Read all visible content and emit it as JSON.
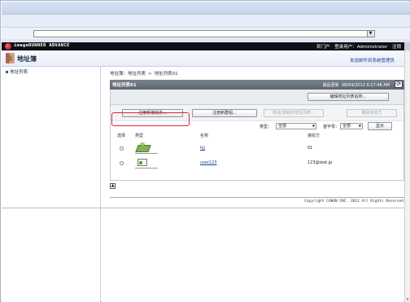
{
  "browser": {
    "address_value": ""
  },
  "app": {
    "product_name": "imageRUNNER ADVANCE",
    "top_links": [
      "到门户",
      "登录用户：Administrator",
      "注销"
    ]
  },
  "header": {
    "title": "地址簿",
    "manage_link": "发送邮件到系统管理员"
  },
  "sidebar": {
    "items": [
      {
        "label": "地址列表"
      }
    ]
  },
  "breadcrumb": {
    "items": [
      "地址簿：地址列表",
      "地址列表01"
    ]
  },
  "panel": {
    "title": "地址列表01",
    "last_updated_label": "最后更新",
    "last_updated_value": "08/04/2012 9:17:48 AM",
    "refresh_icon": "refresh-icon",
    "edit_name_button": "编辑地址列表名称...",
    "buttons": {
      "register_destination": "注册新接收方...",
      "register_group": "注册新群组...",
      "move_copy": "移动/复制到地址列表...",
      "delete": "删除接收方"
    },
    "filter": {
      "type_label": "类型：",
      "type_value": "全部",
      "index_label": "首字母：",
      "index_value": "全部",
      "show_button": "显示"
    },
    "table": {
      "columns": [
        "选择",
        "类型",
        "名称",
        "接收方"
      ],
      "rows": [
        {
          "type_icon": "group-icon",
          "name": "hjj",
          "destination": "01"
        },
        {
          "type_icon": "email-icon",
          "name": "user123",
          "destination": "123@test.jp"
        }
      ]
    },
    "collapse_icon": "collapse-icon"
  },
  "footer": {
    "copyright": "Copyright CANON INC. 2012 All Rights Reserved"
  },
  "colors": {
    "app_bar": "#0d1117",
    "highlight": "#e0232b",
    "link": "#1a3e9c"
  }
}
